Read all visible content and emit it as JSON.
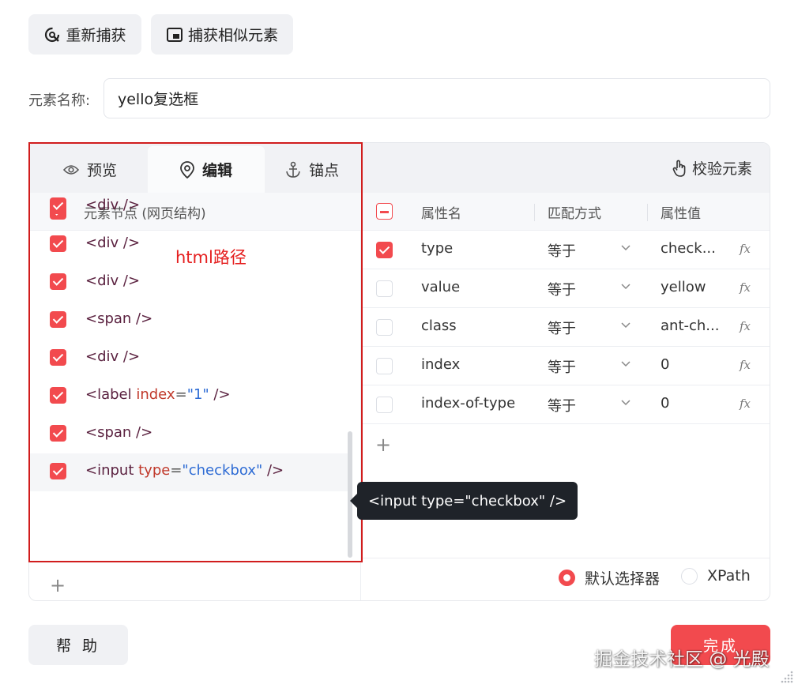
{
  "toolbar": {
    "recapture_label": "重新捕获",
    "capture_similar_label": "捕获相似元素"
  },
  "element_name": {
    "label": "元素名称:",
    "value": "yello复选框"
  },
  "tabs": [
    {
      "label": "预览",
      "icon": "eye-icon"
    },
    {
      "label": "编辑",
      "icon": "location-pin-icon"
    },
    {
      "label": "锚点",
      "icon": "anchor-icon"
    }
  ],
  "verify_label": "校验元素",
  "tree": {
    "header_label": "元素节点 (网页结构)",
    "nodes": [
      {
        "tag": "<div />",
        "checked": true
      },
      {
        "tag": "<div />",
        "checked": true
      },
      {
        "tag": "<div />",
        "checked": true
      },
      {
        "tag": "<span />",
        "checked": true
      },
      {
        "tag": "<div />",
        "checked": true
      },
      {
        "tag_open": "<label ",
        "attr": "index",
        "eq": "=",
        "val": "\"1\"",
        "tag_close": " />",
        "checked": true
      },
      {
        "tag": "<span />",
        "checked": true
      },
      {
        "tag_open": "<input ",
        "attr": "type",
        "eq": "=",
        "val": "\"checkbox\"",
        "tag_close": " />",
        "checked": true,
        "selected": true
      }
    ],
    "add_symbol": "+"
  },
  "annotation": "html路径",
  "attr_table": {
    "headers": {
      "name": "属性名",
      "match": "匹配方式",
      "value": "属性值"
    },
    "rows": [
      {
        "name": "type",
        "match": "等于",
        "value": "check...",
        "checked": true
      },
      {
        "name": "value",
        "match": "等于",
        "value": "yellow",
        "checked": false
      },
      {
        "name": "class",
        "match": "等于",
        "value": "ant-ch...",
        "checked": false
      },
      {
        "name": "index",
        "match": "等于",
        "value": "0",
        "checked": false
      },
      {
        "name": "index-of-type",
        "match": "等于",
        "value": "0",
        "checked": false
      }
    ],
    "fx_label": "fx",
    "add_symbol": "+"
  },
  "selector_mode": {
    "default_label": "默认选择器",
    "xpath_label": "XPath",
    "selected": "default"
  },
  "tooltip": "<input type=\"checkbox\" />",
  "footer": {
    "help_label": "帮 助",
    "done_label": "完成"
  },
  "watermark": "掘金技术社区 @ 光殿",
  "colors": {
    "accent": "#f24a4e",
    "annotation": "#d11d1d",
    "tooltip_bg": "#1f2329"
  }
}
